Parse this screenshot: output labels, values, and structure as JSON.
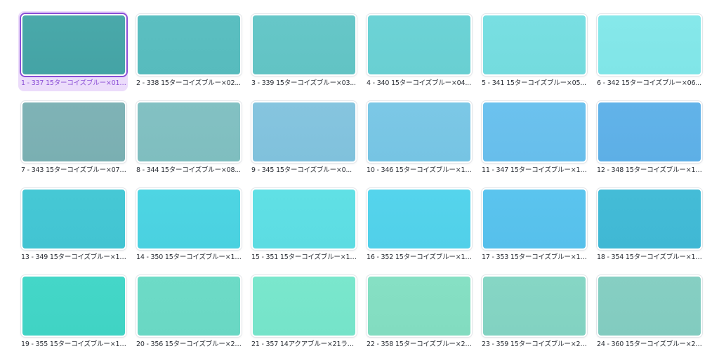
{
  "selected_index": 0,
  "tiles": [
    {
      "label": "1 - 337 15ターコイズブルー×01ブ...",
      "color_top": "#4aa9aa",
      "color_bottom": "#44a3a5"
    },
    {
      "label": "2 - 338 15ターコイズブルー×02...",
      "color_top": "#5bbfc1",
      "color_bottom": "#57bbbd"
    },
    {
      "label": "3 - 339 15ターコイズブルー×03...",
      "color_top": "#66c7c8",
      "color_bottom": "#62c3c4"
    },
    {
      "label": "4 - 340 15ターコイズブルー×04...",
      "color_top": "#6cd3d6",
      "color_bottom": "#69cfd2"
    },
    {
      "label": "5 - 341 15ターコイズブルー×05...",
      "color_top": "#78dfe2",
      "color_bottom": "#74dbde"
    },
    {
      "label": "6 - 342 15ターコイズブルー×06...",
      "color_top": "#86e8ea",
      "color_bottom": "#80e5e7"
    },
    {
      "label": "7 - 343 15ターコイズブルー×07明...",
      "color_top": "#7fb3b6",
      "color_bottom": "#7aafb2"
    },
    {
      "label": "8 - 344 15ターコイズブルー×08...",
      "color_top": "#83c1c3",
      "color_bottom": "#7fbebf"
    },
    {
      "label": "9 - 345 15ターコイズブルー×0...",
      "color_top": "#86c5df",
      "color_bottom": "#80c1dc"
    },
    {
      "label": "10 - 346 15ターコイズブルー×10...",
      "color_top": "#7cc8e6",
      "color_bottom": "#76c4e3"
    },
    {
      "label": "11 - 347 15ターコイズブルー×11...",
      "color_top": "#6cc2ee",
      "color_bottom": "#67beeb"
    },
    {
      "label": "12 - 348 15ターコイズブルー×12...",
      "color_top": "#62b3e9",
      "color_bottom": "#5dafe6"
    },
    {
      "label": "13 - 349 15ターコイズブルー×13...",
      "color_top": "#46c8d5",
      "color_bottom": "#42c4d2"
    },
    {
      "label": "14 - 350 15ターコイズブルー×14...",
      "color_top": "#4ed5e3",
      "color_bottom": "#4ad1e0"
    },
    {
      "label": "15 - 351 15ターコイズブルー×15...",
      "color_top": "#60e0e5",
      "color_bottom": "#5cdce2"
    },
    {
      "label": "16 - 352 15ターコイズブルー×16...",
      "color_top": "#55d4ec",
      "color_bottom": "#51d0e9"
    },
    {
      "label": "17 - 353 15ターコイズブルー×17...",
      "color_top": "#5bc4ee",
      "color_bottom": "#56c0eb"
    },
    {
      "label": "18 - 354 15ターコイズブルー×18...",
      "color_top": "#44bcd7",
      "color_bottom": "#40b8d4"
    },
    {
      "label": "19 - 355 15ターコイズブルー×19...",
      "color_top": "#44d7c8",
      "color_bottom": "#40d3c4"
    },
    {
      "label": "20 - 356 15ターコイズブルー×20...",
      "color_top": "#6ddbc7",
      "color_bottom": "#69d7c3"
    },
    {
      "label": "21 - 357 14アクアブルー×21ライム",
      "color_top": "#7ae7cd",
      "color_bottom": "#75e3c9"
    },
    {
      "label": "22 - 358 15ターコイズブルー×22...",
      "color_top": "#86e0c4",
      "color_bottom": "#82dcc0"
    },
    {
      "label": "23 - 359 15ターコイズブルー×23...",
      "color_top": "#86d6c5",
      "color_bottom": "#82d2c1"
    },
    {
      "label": "24 - 360 15ターコイズブルー×24...",
      "color_top": "#86cfc3",
      "color_bottom": "#82cbbf"
    }
  ]
}
